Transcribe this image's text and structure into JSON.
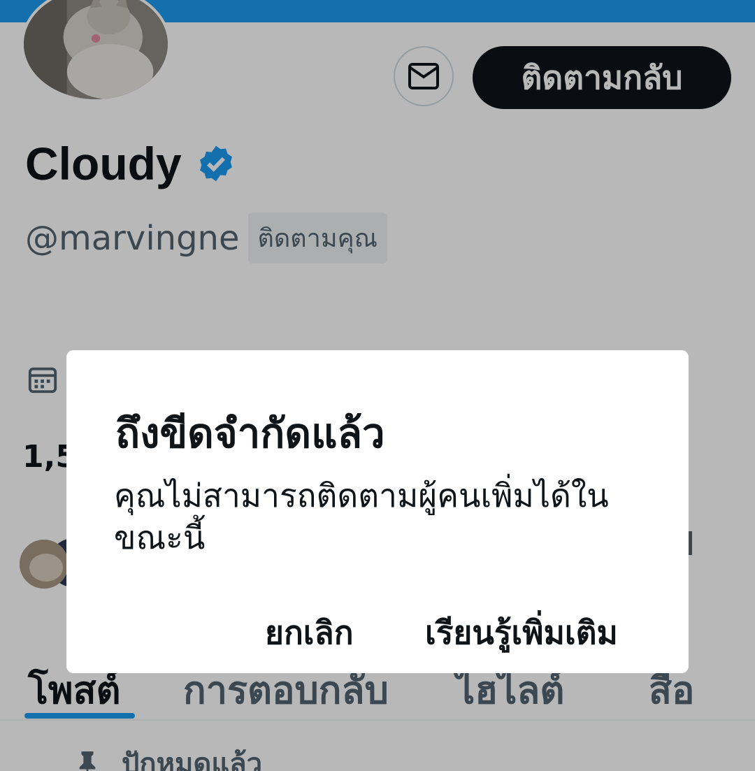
{
  "profile": {
    "name": "Cloudy",
    "handle": "@marvingne",
    "follows_you_badge": "ติดตามคุณ",
    "follow_back_label": "ติดตามกลับ",
    "message_icon": "envelope-icon",
    "verified_icon": "verified-badge-icon",
    "stats_partial": "1,5"
  },
  "tabs": [
    {
      "label": "โพสต์",
      "active": true
    },
    {
      "label": "การตอบกลับ",
      "active": false
    },
    {
      "label": "ไฮไลต์",
      "active": false
    },
    {
      "label": "สื่อ",
      "active": false
    }
  ],
  "pinned": {
    "label": "ปักหมุดแล้ว",
    "icon": "pin-icon"
  },
  "dialog": {
    "title": "ถึงขีดจำกัดแล้ว",
    "body": "คุณไม่สามารถติดตามผู้คนเพิ่มได้ในขณะนี้",
    "cancel_label": "ยกเลิก",
    "learn_more_label": "เรียนรู้เพิ่มเติม"
  },
  "colors": {
    "accent": "#1d9bf0",
    "text_primary": "#0f1419",
    "text_secondary": "#536471",
    "follow_button_bg": "#0f1419"
  }
}
